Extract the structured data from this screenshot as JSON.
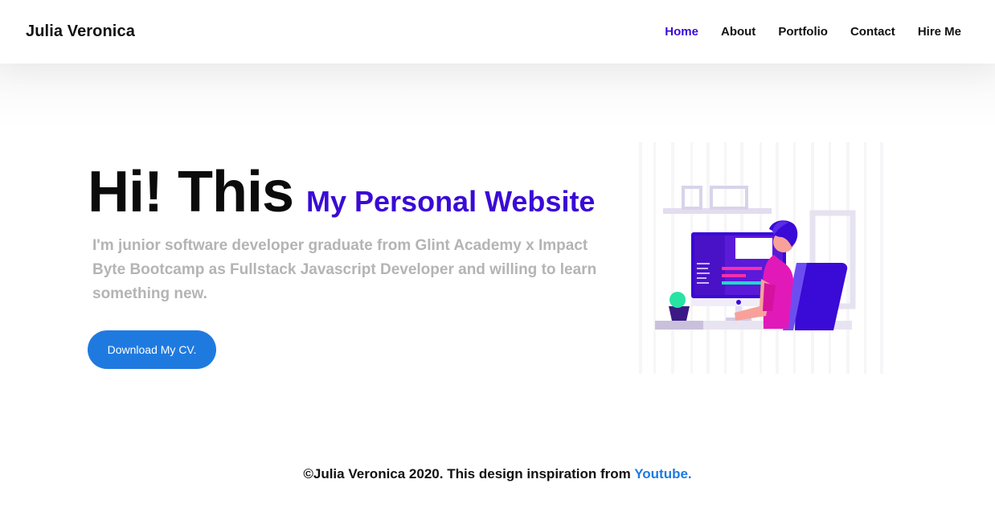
{
  "nav": {
    "brand": "Julia Veronica",
    "links": [
      {
        "label": "Home",
        "active": true
      },
      {
        "label": "About",
        "active": false
      },
      {
        "label": "Portfolio",
        "active": false
      },
      {
        "label": "Contact",
        "active": false
      },
      {
        "label": "Hire Me",
        "active": false
      }
    ]
  },
  "hero": {
    "greeting": "Hi! This",
    "subtitle": "My Personal Website",
    "description": "I'm junior software developer graduate from Glint Academy x Impact Byte Bootcamp as Fullstack Javascript Developer and willing to learn something new.",
    "cta_label": "Download My CV."
  },
  "footer": {
    "text": "©Julia Veronica 2020. This design inspiration from ",
    "link_label": "Youtube."
  },
  "colors": {
    "accent": "#3a0ad6",
    "button": "#1f7ae0",
    "muted_text": "#b4b4b4"
  }
}
